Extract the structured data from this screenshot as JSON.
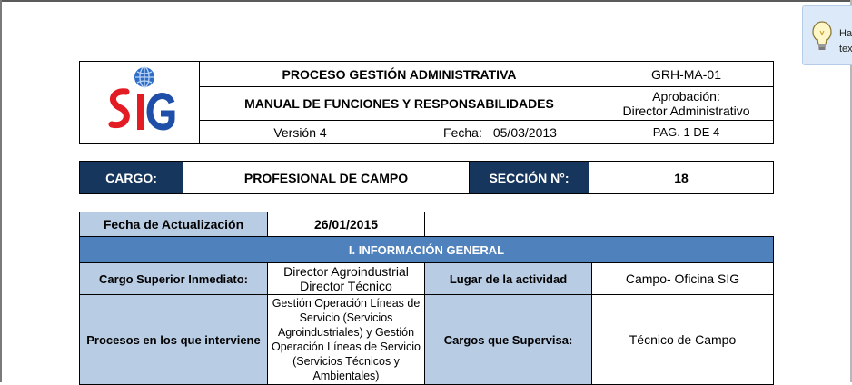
{
  "hint": {
    "line1": "Ha",
    "line2": "tex",
    "icon": "lightbulb-icon"
  },
  "header": {
    "process": "PROCESO GESTIÓN ADMINISTRATIVA",
    "manual": "MANUAL DE FUNCIONES Y RESPONSABILIDADES",
    "code": "GRH-MA-01",
    "approval_label": "Aprobación:",
    "approval_value": "Director Administrativo",
    "version": "Versión  4",
    "date_label": "Fecha:",
    "date_value": "05/03/2013",
    "page": "PAG. 1 DE 4",
    "logo_text": "SIG"
  },
  "cargo": {
    "label": "CARGO:",
    "value": "PROFESIONAL DE CAMPO",
    "section_label": "SECCIÓN N°:",
    "section_value": "18"
  },
  "info": {
    "update_label": "Fecha de Actualización",
    "update_value": "26/01/2015",
    "section_title": "I. INFORMACIÓN GENERAL",
    "superior_label": "Cargo Superior Inmediato:",
    "superior_line1": "Director Agroindustrial",
    "superior_line2": "Director Técnico",
    "place_label": "Lugar de la actividad",
    "place_value": "Campo- Oficina SIG",
    "processes_label": "Procesos en los que interviene",
    "processes_value": "Gestión Operación Líneas de Servicio (Servicios Agroindustriales) y Gestión Operación Líneas de Servicio (Servicios Técnicos y Ambientales)",
    "supervises_label": "Cargos que  Supervisa:",
    "supervises_value": "Técnico de Campo"
  },
  "colors": {
    "navy": "#17365d",
    "light_blue": "#b8cce4",
    "mid_blue": "#4f81bd",
    "logo_red": "#e31b23",
    "logo_blue": "#1f4fa8"
  }
}
